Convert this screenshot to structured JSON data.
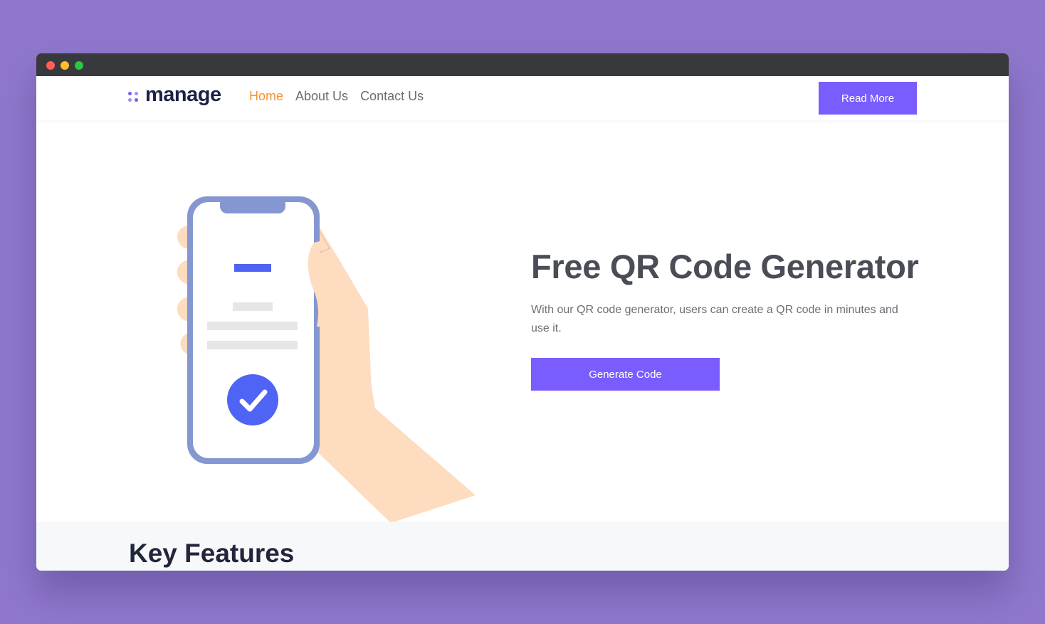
{
  "window": {
    "controls": [
      "close",
      "minimize",
      "maximize"
    ]
  },
  "brand": {
    "name": "manage",
    "logo_icon": "four-dots-icon",
    "accent_color": "#7b5cff",
    "active_link_color": "#f5932e"
  },
  "nav": {
    "links": [
      {
        "label": "Home",
        "active": true
      },
      {
        "label": "About Us",
        "active": false
      },
      {
        "label": "Contact Us",
        "active": false
      }
    ],
    "cta_label": "Read More"
  },
  "hero": {
    "title": "Free QR Code Generator",
    "description": "With our QR code generator, users can create a QR code in minutes and use it.",
    "cta_label": "Generate Code",
    "illustration": "hand-holding-phone-with-checkmark"
  },
  "features": {
    "title": "Key Features"
  }
}
